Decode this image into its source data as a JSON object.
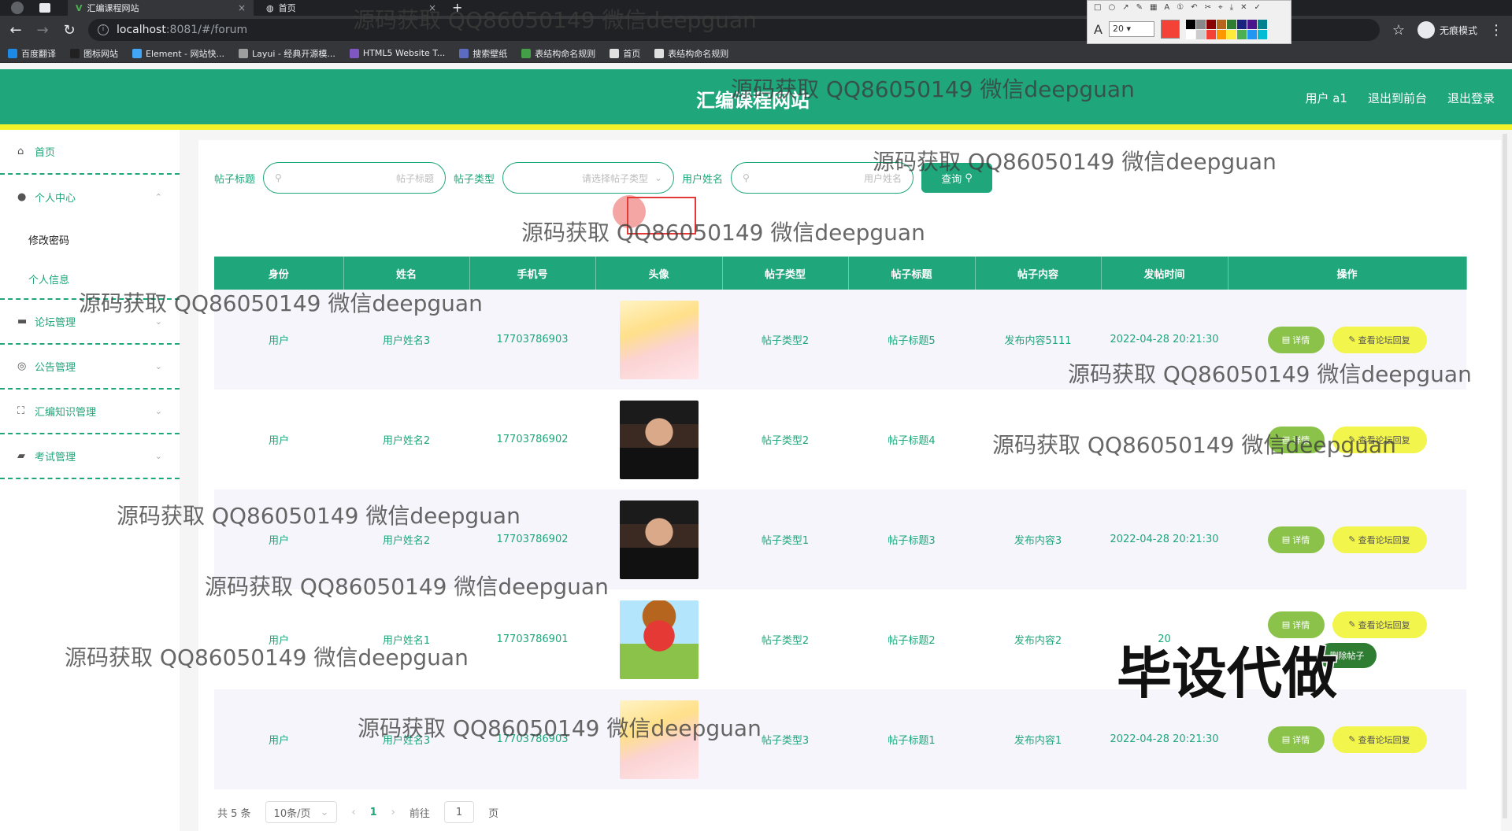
{
  "browser": {
    "tabs": [
      {
        "title": "汇编课程网站",
        "active": true
      },
      {
        "title": "首页",
        "active": false
      }
    ],
    "new_tab": "+",
    "url_host": "localhost",
    "url_rest": ":8081/#/forum",
    "incognito_label": "无痕模式",
    "bookmarks": [
      {
        "label": "百度翻译",
        "color": "#1e88e5"
      },
      {
        "label": "图标网站",
        "color": "#212121"
      },
      {
        "label": "Element - 网站快...",
        "color": "#42a5f5"
      },
      {
        "label": "Layui - 经典开源模...",
        "color": "#9e9e9e"
      },
      {
        "label": "HTML5 Website T...",
        "color": "#7e57c2"
      },
      {
        "label": "搜索壁纸",
        "color": "#5c6bc0"
      },
      {
        "label": "表结构命名规则",
        "color": "#43a047"
      },
      {
        "label": "首页",
        "color": "#e0e0e0"
      },
      {
        "label": "表结构命名规则",
        "color": "#e0e0e0"
      }
    ]
  },
  "annot_toolbar": {
    "font_label": "A",
    "size_value": "20",
    "current_color": "#f44336",
    "palette": [
      "#000000",
      "#888888",
      "#8b0000",
      "#b5651d",
      "#2e7d32",
      "#1a237e",
      "#4a148c",
      "#00838f",
      "#ffffff",
      "#cccccc",
      "#f44336",
      "#ff9800",
      "#ffeb3b",
      "#4caf50",
      "#2196f3",
      "#00bcd4"
    ]
  },
  "app": {
    "title": "汇编课程网站",
    "user_label": "用户 a1",
    "back_front": "退出到前台",
    "logout": "退出登录",
    "accent": "#1fa67a",
    "stripe": "#f2f22a"
  },
  "sidebar": {
    "home": "首页",
    "personal_center": "个人中心",
    "sub_items": [
      "修改密码",
      "个人信息"
    ],
    "menus": [
      "论坛管理",
      "公告管理",
      "汇编知识管理",
      "考试管理"
    ]
  },
  "search": {
    "title_label": "帖子标题",
    "title_placeholder": "帖子标题",
    "type_label": "帖子类型",
    "type_placeholder": "请选择帖子类型",
    "user_label": "用户姓名",
    "user_placeholder": "用户姓名",
    "button": "查询"
  },
  "table": {
    "headers": [
      "身份",
      "姓名",
      "手机号",
      "头像",
      "帖子类型",
      "帖子标题",
      "帖子内容",
      "发帖时间",
      "操作"
    ],
    "rows": [
      {
        "role": "用户",
        "name": "用户姓名3",
        "phone": "17703786903",
        "avatar": "anime-girl",
        "type": "帖子类型2",
        "title": "帖子标题5",
        "content": "发布内容5111",
        "time": "2022-04-28 20:21:30"
      },
      {
        "role": "用户",
        "name": "用户姓名2",
        "phone": "17703786902",
        "avatar": "man-photo",
        "type": "帖子类型2",
        "title": "帖子标题4",
        "content": "",
        "time": ""
      },
      {
        "role": "用户",
        "name": "用户姓名2",
        "phone": "17703786902",
        "avatar": "man-photo",
        "type": "帖子类型1",
        "title": "帖子标题3",
        "content": "发布内容3",
        "time": "2022-04-28 20:21:30"
      },
      {
        "role": "用户",
        "name": "用户姓名1",
        "phone": "17703786901",
        "avatar": "cartoon-fox",
        "type": "帖子类型2",
        "title": "帖子标题2",
        "content": "发布内容2",
        "time": "20"
      },
      {
        "role": "用户",
        "name": "用户姓名3",
        "phone": "17703786903",
        "avatar": "anime-girl",
        "type": "帖子类型3",
        "title": "帖子标题1",
        "content": "发布内容1",
        "time": "2022-04-28 20:21:30"
      }
    ],
    "detail_btn": "详情",
    "reply_btn": "查看论坛回复",
    "delete_btn": "删除帖子"
  },
  "pager": {
    "total": "共 5 条",
    "page_size": "10条/页",
    "current": "1",
    "goto_prefix": "前往",
    "goto_value": "1",
    "goto_suffix": "页"
  },
  "watermarks": {
    "text": "源码获取 QQ86050149 微信deepguan",
    "banner": "毕设代做"
  }
}
